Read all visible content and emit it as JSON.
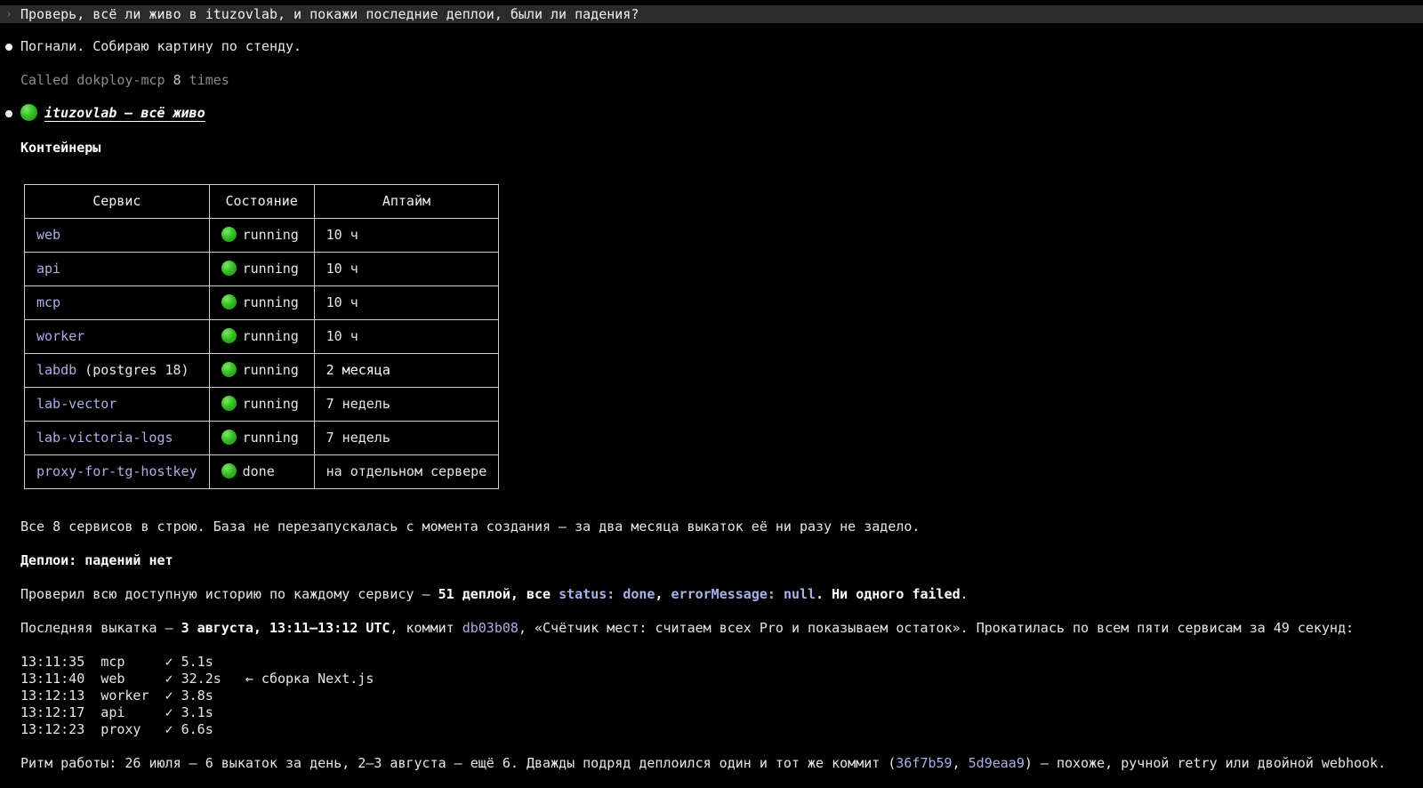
{
  "prompt": {
    "glyph": "›",
    "text": "Проверь, всё ли живо в ituzovlab, и покажи последние деплои, были ли падения?"
  },
  "reply_intro": "Погнали. Собираю картину по стенду.",
  "tool_call": {
    "prefix": "Called dokploy-mcp ",
    "count": "8",
    "suffix": " times"
  },
  "heading": "ituzovlab — всё живо",
  "containers_title": "Контейнеры",
  "table": {
    "headers": [
      "Сервис",
      "Состояние",
      "Аптайм"
    ],
    "rows": [
      {
        "service": "web",
        "extra": "",
        "state": "running",
        "uptime": "10 ч",
        "bold": false
      },
      {
        "service": "api",
        "extra": "",
        "state": "running",
        "uptime": "10 ч",
        "bold": false
      },
      {
        "service": "mcp",
        "extra": "",
        "state": "running",
        "uptime": "10 ч",
        "bold": false
      },
      {
        "service": "worker",
        "extra": "",
        "state": "running",
        "uptime": "10 ч",
        "bold": false
      },
      {
        "service": "labdb",
        "extra": " (postgres 18)",
        "state": "running",
        "uptime": "2 месяца",
        "bold": true
      },
      {
        "service": "lab-vector",
        "extra": "",
        "state": "running",
        "uptime": "7 недель",
        "bold": false
      },
      {
        "service": "lab-victoria-logs",
        "extra": "",
        "state": "running",
        "uptime": "7 недель",
        "bold": false
      },
      {
        "service": "proxy-for-tg-hostkey",
        "extra": "",
        "state": "done",
        "uptime": "на отдельном сервере",
        "bold": false
      }
    ]
  },
  "summary": "Все 8 сервисов в строю. База не перезапускалась с момента создания — за два месяца выкаток её ни разу не задело.",
  "deploys_title": "Деплои: падений нет",
  "history": {
    "p1": "Проверил всю доступную историю по каждому сервису — ",
    "b1": "51 деплой, все ",
    "a1": "status: done",
    "p2": ", ",
    "a2": "errorMessage: null",
    "b2": ". Ни одного failed",
    "p3": "."
  },
  "last_rollout": {
    "p1": "Последняя выкатка — ",
    "b1": "3 августа, 13:11–13:12 UTC",
    "p2": ", коммит ",
    "commit": "db03b08",
    "p3": ", «Счётчик мест: считаем всех Pro и показываем остаток». Прокатилась по всем пяти сервисам за 49 секунд:"
  },
  "timings": [
    "13:11:35  mcp     ✓ 5.1s",
    "13:11:40  web     ✓ 32.2s   ← сборка Next.js",
    "13:12:13  worker  ✓ 3.8s",
    "13:12:17  api     ✓ 3.1s",
    "13:12:23  proxy   ✓ 6.6s"
  ],
  "rhythm": {
    "p1": "Ритм работы: 26 июля — 6 выкаток за день, 2–3 августа — ещё 6. Дважды подряд деплоился один и тот же коммит (",
    "c1": "36f7b59",
    "p2": ", ",
    "c2": "5d9eaa9",
    "p3": ") — похоже, ручной retry или двойной webhook."
  },
  "colors": {
    "background": "#000000",
    "text": "#e6e6e6",
    "accent": "#a9b0e8",
    "status_ok": "#34c021",
    "prompt_bar": "#2b2b2b"
  },
  "icons": {
    "status": "green-circle-icon",
    "bullet": "bullet-dot-icon"
  }
}
